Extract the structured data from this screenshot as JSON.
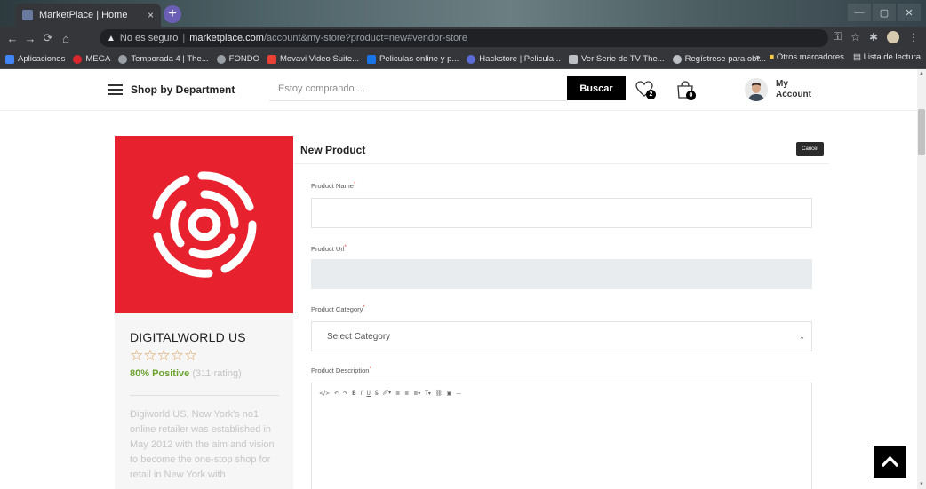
{
  "browser": {
    "tab_title": "MarketPlace | Home",
    "tab_close": "×",
    "new_tab": "+",
    "security_label": "No es seguro",
    "url_host": "marketplace.com",
    "url_path": "/account&my-store?product=new#vendor-store",
    "bookmarks": [
      {
        "label": "Aplicaciones",
        "color": "#4285f4"
      },
      {
        "label": "MEGA",
        "color": "#d9272e"
      },
      {
        "label": "Temporada 4 | The...",
        "color": "#9aa0a6"
      },
      {
        "label": "FONDO",
        "color": "#9aa0a6"
      },
      {
        "label": "Movavi Video Suite...",
        "color": "#e94235"
      },
      {
        "label": "Peliculas online y p...",
        "color": "#1a73e8"
      },
      {
        "label": "Hackstore | Pelicula...",
        "color": "#5b6cd6"
      },
      {
        "label": "Ver Serie de TV The...",
        "color": "#bdc1c6"
      },
      {
        "label": "Regístrese para obt...",
        "color": "#bdc1c6"
      }
    ],
    "bookmarks_more": "»",
    "other_bookmarks": "Otros marcadores",
    "reading_list": "Lista de lectura"
  },
  "header": {
    "shop_by_department": "Shop by Department",
    "search_placeholder": "Estoy comprando ...",
    "search_button": "Buscar",
    "wishlist_count": "2",
    "cart_count": "0",
    "my_account": "My Account"
  },
  "vendor": {
    "name": "DIGITALWORLD US",
    "stars": "☆☆☆☆☆",
    "positive": "80% Positive",
    "rating": "(311 rating)",
    "description": "Digiworld US, New York's no1 online retailer was established in May 2012 with the aim and vision to become the one-stop shop for retail in New York with"
  },
  "form": {
    "title": "New Product",
    "cancel": "Cancel",
    "product_name_label": "Product Name",
    "product_url_label": "Product Url",
    "product_category_label": "Product Category",
    "category_placeholder": "Select Category",
    "product_description_label": "Product Description",
    "required_mark": "*",
    "editor_tools": [
      "</>",
      "↶",
      "↷",
      "B",
      "I",
      "U",
      "S̶",
      "🖉▾",
      "≣",
      "≣",
      "≣▾",
      "T▾",
      "⛓",
      "▣",
      "—"
    ]
  },
  "colors": {
    "brand_red": "#e8212e",
    "positive_green": "#6aa12f",
    "star_orange": "#d89b52"
  }
}
